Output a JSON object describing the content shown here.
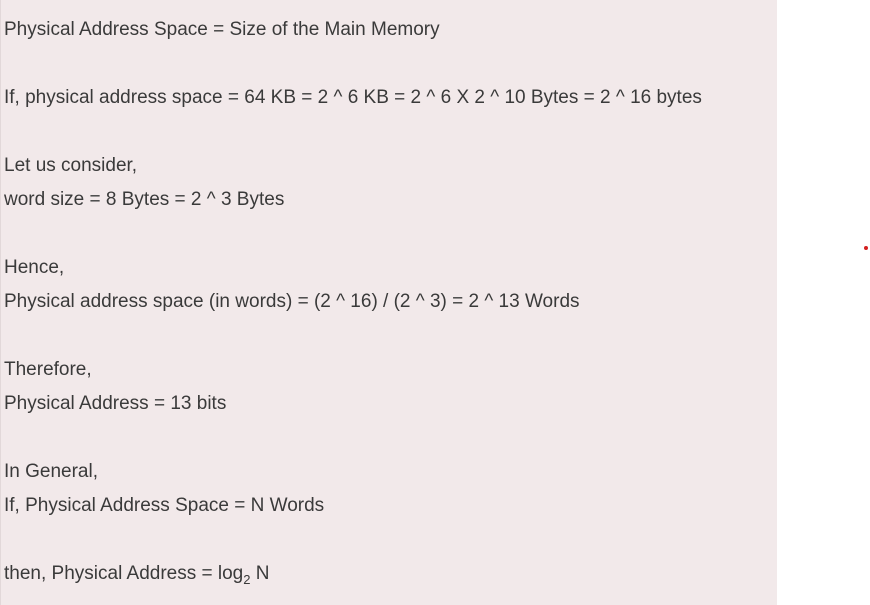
{
  "content": {
    "line_1": "Physical Address Space = Size of the Main Memory",
    "line_2": "If, physical address space = 64 KB = 2 ^ 6 KB = 2 ^ 6 X 2 ^ 10 Bytes = 2 ^ 16 bytes",
    "line_3": "Let us consider,",
    "line_4": "word size = 8 Bytes = 2 ^ 3 Bytes",
    "line_5": "Hence,",
    "line_6": "Physical address space (in words) = (2 ^ 16) / (2 ^ 3) = 2 ^ 13 Words",
    "line_7": "Therefore,",
    "line_8": "Physical Address = 13 bits",
    "line_9": "In General,",
    "line_10": "If, Physical Address Space = N Words",
    "line_11_prefix": "then, Physical Address = log",
    "line_11_subscript": "2",
    "line_11_suffix": " N"
  },
  "colors": {
    "box_background": "#f2e9ea",
    "text": "#3a3a3a",
    "marker_dot": "#d32020"
  }
}
